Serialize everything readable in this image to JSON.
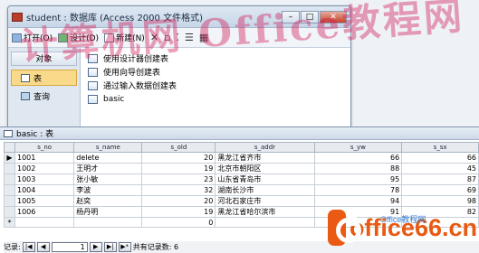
{
  "db_window": {
    "title": "student : 数据库 (Access 2000 文件格式)",
    "buttons": {
      "minimize": "–",
      "maximize": "□",
      "close": "✕"
    }
  },
  "toolbar": {
    "open": "打开(O)",
    "design": "设计(D)",
    "new": "新建(N)",
    "delete_symbol": "✕"
  },
  "objects": {
    "header": "对象",
    "items": [
      {
        "label": "表",
        "icon": "table-icon",
        "selected": true
      },
      {
        "label": "查询",
        "icon": "query-icon",
        "selected": false
      }
    ]
  },
  "object_list": [
    {
      "label": "使用设计器创建表",
      "icon": "design-table-icon"
    },
    {
      "label": "使用向导创建表",
      "icon": "wizard-table-icon"
    },
    {
      "label": "通过输入数据创建表",
      "icon": "datasheet-table-icon"
    },
    {
      "label": "basic",
      "icon": "table-icon"
    }
  ],
  "watermark": "计算机网 Office教程网",
  "table_window": {
    "title": "basic : 表",
    "columns": [
      "s_no",
      "s_name",
      "s_old",
      "s_addr",
      "s_yw",
      "s_sx"
    ],
    "rows": [
      [
        "1001",
        "delete",
        "20",
        "黑龙江省齐市",
        "66",
        "66"
      ],
      [
        "1002",
        "王明才",
        "19",
        "北京市朝阳区",
        "88",
        "45"
      ],
      [
        "1003",
        "张小敏",
        "23",
        "山东省青岛市",
        "95",
        "87"
      ],
      [
        "1004",
        "李波",
        "32",
        "湖南长沙市",
        "78",
        "69"
      ],
      [
        "1005",
        "赵奕",
        "20",
        "河北石家庄市",
        "94",
        "98"
      ],
      [
        "1006",
        "杨丹明",
        "19",
        "黑龙江省哈尔滨市",
        "91",
        "82"
      ]
    ],
    "new_row": {
      "marker": "*",
      "s_old": "0"
    }
  },
  "navigator": {
    "label": "记录:",
    "current": "1",
    "total_label": "共有记录数: 6"
  },
  "logo": {
    "text": "office66.cn",
    "sub": "Office教程网"
  }
}
